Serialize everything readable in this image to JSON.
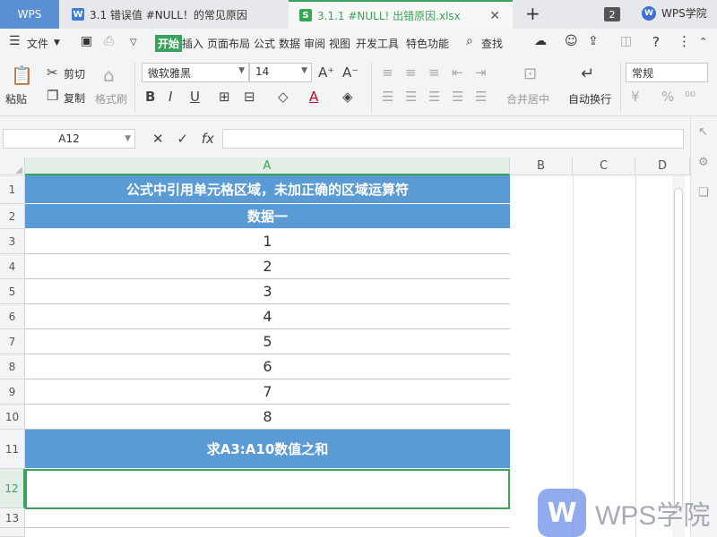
{
  "tabs": {
    "home": "WPS",
    "doc_icon": "W",
    "doc": "3.1 错误值 #NULL！的常见原因",
    "xls_icon": "S",
    "xls": "3.1.1 #NULL! 出错原因.xlsx",
    "close": "✕",
    "add": "+",
    "window_count": "2",
    "academy": "WPS学院"
  },
  "menubar": {
    "file": "文件",
    "items": [
      "开始",
      "插入",
      "页面布局",
      "公式",
      "数据",
      "审阅",
      "视图",
      "开发工具",
      "特色功能"
    ],
    "search": "查找"
  },
  "ribbon": {
    "paste": "粘贴",
    "cut": "剪切",
    "copy": "复制",
    "format_painter": "格式刷",
    "font_name": "微软雅黑",
    "font_size": "14",
    "bold": "B",
    "italic": "I",
    "underline": "U",
    "merge_center": "合并居中",
    "wrap_text": "自动换行",
    "number_format": "常规"
  },
  "formula_bar": {
    "name_box": "A12",
    "fx": "fx",
    "content": ""
  },
  "sheet": {
    "columns": [
      "A",
      "B",
      "C",
      "D"
    ],
    "rows": [
      {
        "num": "1",
        "value": "公式中引用单元格区域，未加正确的区域运算符",
        "header": true
      },
      {
        "num": "2",
        "value": "数据一",
        "header": true
      },
      {
        "num": "3",
        "value": "1"
      },
      {
        "num": "4",
        "value": "2"
      },
      {
        "num": "5",
        "value": "3"
      },
      {
        "num": "6",
        "value": "4"
      },
      {
        "num": "7",
        "value": "5"
      },
      {
        "num": "8",
        "value": "6"
      },
      {
        "num": "9",
        "value": "7"
      },
      {
        "num": "10",
        "value": "8"
      },
      {
        "num": "11",
        "value": "求A3:A10数值之和",
        "header": true
      },
      {
        "num": "12",
        "value": "",
        "selected": true
      },
      {
        "num": "13",
        "value": ""
      }
    ]
  },
  "watermark": {
    "logo": "W",
    "text": "WPS学院"
  },
  "colors": {
    "accent": "#3aa35b",
    "header_fill": "#5b9bd5"
  }
}
